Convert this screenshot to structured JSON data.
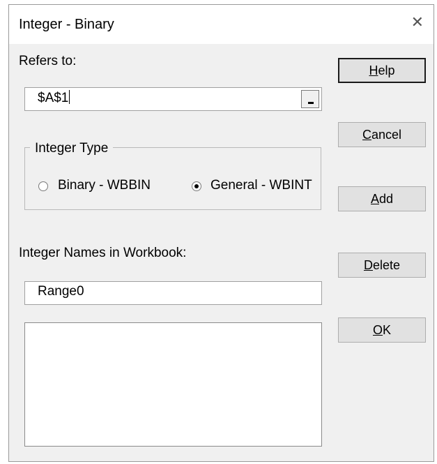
{
  "window": {
    "title": "Integer - Binary"
  },
  "refers_to": {
    "label": "Refers to:",
    "value": "$A$1"
  },
  "integer_type": {
    "group_label": "Integer Type",
    "options": [
      {
        "label": "Binary - WBBIN",
        "checked": false
      },
      {
        "label": "General - WBINT",
        "checked": true
      }
    ]
  },
  "integer_names": {
    "label": "Integer Names in Workbook:",
    "name_value": "Range0",
    "list_items": []
  },
  "buttons": {
    "help": {
      "mnemonic": "H",
      "rest": "elp"
    },
    "cancel": {
      "mnemonic": "C",
      "rest": "ancel"
    },
    "add": {
      "mnemonic": "A",
      "rest": "dd"
    },
    "delete": {
      "mnemonic": "D",
      "rest": "elete"
    },
    "ok": {
      "mnemonic": "O",
      "rest": "K"
    }
  },
  "icons": {
    "close": "close-icon"
  }
}
